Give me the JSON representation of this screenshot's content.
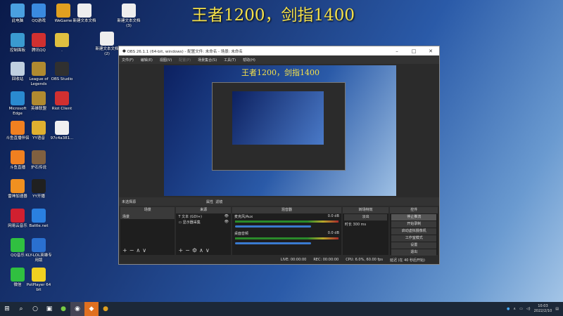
{
  "headline": "王者1200，剑指1400",
  "desktop_icons": [
    {
      "label": "此电脑",
      "color": "#4aa0e0"
    },
    {
      "label": "QQ游戏",
      "color": "#3a8ae0"
    },
    {
      "label": "WeGame",
      "color": "#e0a020"
    },
    {
      "label": "新建文本文档",
      "color": "#eeeeee"
    },
    {
      "label": "新建文本文档 (3)",
      "color": "#eeeeee"
    },
    {
      "label": "控制面板",
      "color": "#3a9ad0"
    },
    {
      "label": "腾讯QQ",
      "color": "#d03030"
    },
    {
      "label": ".",
      "color": "#e0c040"
    },
    {
      "label": "新建文本文档 (2)",
      "color": "#eeeeee"
    },
    {
      "label": "回收站",
      "color": "#c0d0e0"
    },
    {
      "label": "League of Legends",
      "color": "#b08a30"
    },
    {
      "label": "OBS Studio",
      "color": "#303030"
    },
    {
      "label": "Microsoft Edge",
      "color": "#2a8ad0"
    },
    {
      "label": "英雄联盟",
      "color": "#b08a30"
    },
    {
      "label": "Riot Client",
      "color": "#d03030"
    },
    {
      "label": "斗鱼直播伴侣",
      "color": "#f08020"
    },
    {
      "label": "YY语音",
      "color": "#e0b030"
    },
    {
      "label": "97c4a381...",
      "color": "#f0f0f0"
    },
    {
      "label": "斗鱼直播",
      "color": "#f08020"
    },
    {
      "label": "炉石传说",
      "color": "#806040"
    },
    {
      "label": "雷神加速器",
      "color": "#f09020"
    },
    {
      "label": "YY开播",
      "color": "#202020"
    },
    {
      "label": "网易云音乐",
      "color": "#d02030"
    },
    {
      "label": "Battle.net",
      "color": "#2a80e0"
    },
    {
      "label": "QQ音乐",
      "color": "#30c040"
    },
    {
      "label": "KLY-LOL英雄专用版",
      "color": "#2a70d0"
    },
    {
      "label": "微信",
      "color": "#30c040"
    },
    {
      "label": "PotPlayer 64 bit",
      "color": "#f0d020"
    }
  ],
  "obs": {
    "title": "OBS 26.1.1 (64-bit, windows) - 配置文件: 未命名 - 场景: 未命名",
    "menu": [
      "文件(F)",
      "编辑(E)",
      "视图(V)",
      "配置(P)",
      "场景集合(S)",
      "工具(T)",
      "帮助(H)"
    ],
    "preview_text": "王者1200，剑指1400",
    "no_source": "未选择源",
    "properties": "属性",
    "filters": "滤镜",
    "docks": {
      "scenes": "场景",
      "sources": "来源",
      "mixer": "混音器",
      "transitions": "转场特效",
      "controls": "控件"
    },
    "scene_item": "场景",
    "sources": [
      "文本 (GDI+)",
      "显示器采集"
    ],
    "mixer": [
      {
        "name": "麦克风/Aux",
        "db": "0.0 dB"
      },
      {
        "name": "桌面音频",
        "db": "0.0 dB"
      }
    ],
    "transition": "淡出",
    "duration_label": "时长",
    "duration": "300 ms",
    "controls": [
      "停止推流",
      "开始录制",
      "启动虚拟摄像机",
      "工作室模式",
      "设置",
      "退出"
    ],
    "status": {
      "live": "LIVE: 00:00:00",
      "rec": "REC: 00:00:00",
      "cpu": "CPU: 6.0%, 60.00 fps",
      "delay": "延迟 (在 40 秒后开始)"
    }
  },
  "clock": {
    "time": "10:03",
    "date": "2022/2/10"
  }
}
